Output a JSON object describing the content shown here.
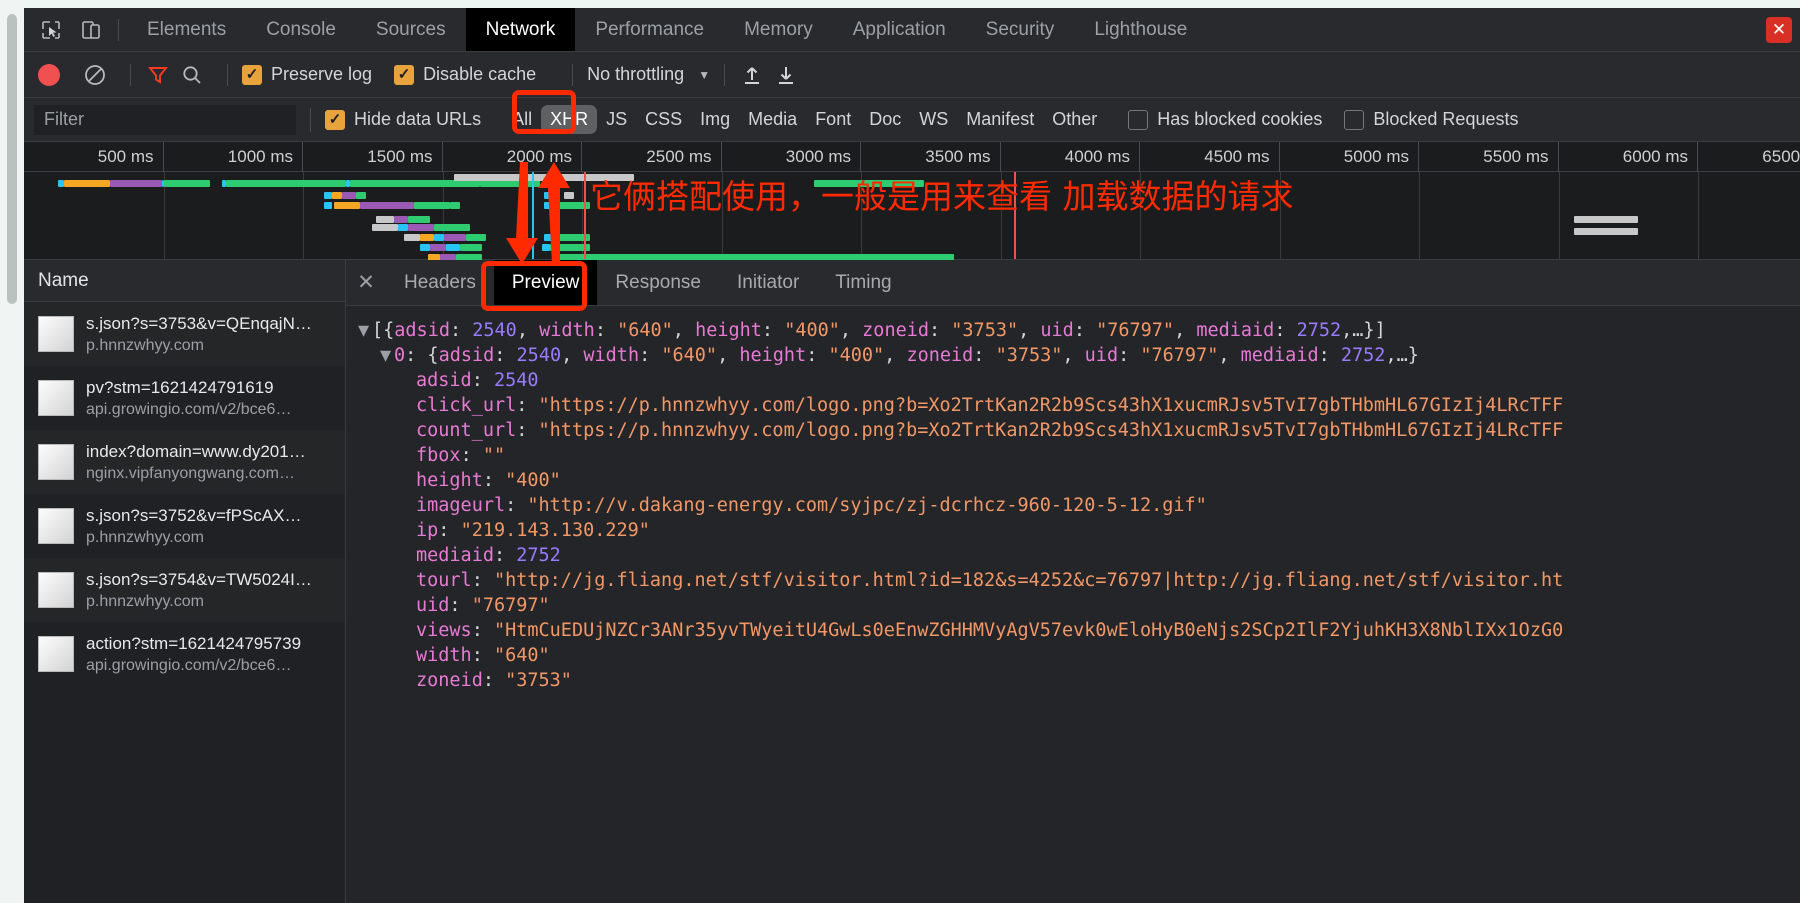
{
  "window": {
    "tabs": [
      {
        "label": "Elements",
        "active": false
      },
      {
        "label": "Console",
        "active": false
      },
      {
        "label": "Sources",
        "active": false
      },
      {
        "label": "Network",
        "active": true
      },
      {
        "label": "Performance",
        "active": false
      },
      {
        "label": "Memory",
        "active": false
      },
      {
        "label": "Application",
        "active": false
      },
      {
        "label": "Security",
        "active": false
      },
      {
        "label": "Lighthouse",
        "active": false
      }
    ],
    "inspect_icon": "cursor-select-icon",
    "device_icon": "device-toolbar-icon",
    "close_icon": "close-icon"
  },
  "toolbar": {
    "record_icon": "record-icon",
    "clear_icon": "clear-icon",
    "filter_icon": "filter-funnel-icon",
    "search_icon": "search-icon",
    "preserve_log": {
      "label": "Preserve log",
      "checked": true
    },
    "disable_cache": {
      "label": "Disable cache",
      "checked": true
    },
    "throttling": "No throttling",
    "throttle_caret": "▼",
    "import_icon": "import-har-icon",
    "export_icon": "export-har-icon"
  },
  "filterbar": {
    "placeholder": "Filter",
    "value": "",
    "hide_data_urls": {
      "label": "Hide data URLs",
      "checked": true
    },
    "types": [
      {
        "label": "All",
        "selected": false
      },
      {
        "label": "XHR",
        "selected": true
      },
      {
        "label": "JS",
        "selected": false
      },
      {
        "label": "CSS",
        "selected": false
      },
      {
        "label": "Img",
        "selected": false
      },
      {
        "label": "Media",
        "selected": false
      },
      {
        "label": "Font",
        "selected": false
      },
      {
        "label": "Doc",
        "selected": false
      },
      {
        "label": "WS",
        "selected": false
      },
      {
        "label": "Manifest",
        "selected": false
      },
      {
        "label": "Other",
        "selected": false
      }
    ],
    "has_blocked_cookies": {
      "label": "Has blocked cookies",
      "checked": false
    },
    "blocked_requests": {
      "label": "Blocked Requests",
      "checked": false
    }
  },
  "overview": {
    "ticks": [
      "500 ms",
      "1000 ms",
      "1500 ms",
      "2000 ms",
      "2500 ms",
      "3000 ms",
      "3500 ms",
      "4000 ms",
      "4500 ms",
      "5000 ms",
      "5500 ms",
      "6000 ms",
      "6500 ms"
    ]
  },
  "requests": {
    "column_header": "Name",
    "rows": [
      {
        "name": "s.json?s=3753&v=QEnqajN…",
        "domain": "p.hnnzwhyy.com"
      },
      {
        "name": "pv?stm=1621424791619",
        "domain": "api.growingio.com/v2/bce6…"
      },
      {
        "name": "index?domain=www.dy201…",
        "domain": "nginx.vipfanyongwang.com…"
      },
      {
        "name": "s.json?s=3752&v=fPScAX…",
        "domain": "p.hnnzwhyy.com"
      },
      {
        "name": "s.json?s=3754&v=TW5024I…",
        "domain": "p.hnnzwhyy.com"
      },
      {
        "name": "action?stm=1621424795739",
        "domain": "api.growingio.com/v2/bce6…"
      }
    ]
  },
  "detail": {
    "close_icon": "close-icon",
    "tabs": [
      {
        "label": "Headers",
        "active": false
      },
      {
        "label": "Preview",
        "active": true
      },
      {
        "label": "Response",
        "active": false
      },
      {
        "label": "Initiator",
        "active": false
      },
      {
        "label": "Timing",
        "active": false
      }
    ],
    "preview_lines": [
      {
        "indent": 0,
        "arrow": "▼",
        "parts": [
          {
            "t": "[{",
            "c": "p"
          },
          {
            "t": "adsid",
            "c": "k"
          },
          {
            "t": ": ",
            "c": "p"
          },
          {
            "t": "2540",
            "c": "n"
          },
          {
            "t": ", ",
            "c": "p"
          },
          {
            "t": "width",
            "c": "k"
          },
          {
            "t": ": ",
            "c": "p"
          },
          {
            "t": "\"640\"",
            "c": "s"
          },
          {
            "t": ", ",
            "c": "p"
          },
          {
            "t": "height",
            "c": "k"
          },
          {
            "t": ": ",
            "c": "p"
          },
          {
            "t": "\"400\"",
            "c": "s"
          },
          {
            "t": ", ",
            "c": "p"
          },
          {
            "t": "zoneid",
            "c": "k"
          },
          {
            "t": ": ",
            "c": "p"
          },
          {
            "t": "\"3753\"",
            "c": "s"
          },
          {
            "t": ", ",
            "c": "p"
          },
          {
            "t": "uid",
            "c": "k"
          },
          {
            "t": ": ",
            "c": "p"
          },
          {
            "t": "\"76797\"",
            "c": "s"
          },
          {
            "t": ", ",
            "c": "p"
          },
          {
            "t": "mediaid",
            "c": "k"
          },
          {
            "t": ": ",
            "c": "p"
          },
          {
            "t": "2752",
            "c": "n"
          },
          {
            "t": ",…}]",
            "c": "p"
          }
        ]
      },
      {
        "indent": 1,
        "arrow": "▼",
        "parts": [
          {
            "t": "0",
            "c": "idx"
          },
          {
            "t": ": {",
            "c": "p"
          },
          {
            "t": "adsid",
            "c": "k"
          },
          {
            "t": ": ",
            "c": "p"
          },
          {
            "t": "2540",
            "c": "n"
          },
          {
            "t": ", ",
            "c": "p"
          },
          {
            "t": "width",
            "c": "k"
          },
          {
            "t": ": ",
            "c": "p"
          },
          {
            "t": "\"640\"",
            "c": "s"
          },
          {
            "t": ", ",
            "c": "p"
          },
          {
            "t": "height",
            "c": "k"
          },
          {
            "t": ": ",
            "c": "p"
          },
          {
            "t": "\"400\"",
            "c": "s"
          },
          {
            "t": ", ",
            "c": "p"
          },
          {
            "t": "zoneid",
            "c": "k"
          },
          {
            "t": ": ",
            "c": "p"
          },
          {
            "t": "\"3753\"",
            "c": "s"
          },
          {
            "t": ", ",
            "c": "p"
          },
          {
            "t": "uid",
            "c": "k"
          },
          {
            "t": ": ",
            "c": "p"
          },
          {
            "t": "\"76797\"",
            "c": "s"
          },
          {
            "t": ", ",
            "c": "p"
          },
          {
            "t": "mediaid",
            "c": "k"
          },
          {
            "t": ": ",
            "c": "p"
          },
          {
            "t": "2752",
            "c": "n"
          },
          {
            "t": ",…}",
            "c": "p"
          }
        ]
      },
      {
        "indent": 2,
        "arrow": "",
        "parts": [
          {
            "t": "adsid",
            "c": "k"
          },
          {
            "t": ": ",
            "c": "p"
          },
          {
            "t": "2540",
            "c": "n"
          }
        ]
      },
      {
        "indent": 2,
        "arrow": "",
        "parts": [
          {
            "t": "click_url",
            "c": "k"
          },
          {
            "t": ": ",
            "c": "p"
          },
          {
            "t": "\"https://p.hnnzwhyy.com/logo.png?b=Xo2TrtKan2R2b9Scs43hX1xucmRJsv5TvI7gbTHbmHL67GIzIj4LRcTFF",
            "c": "s"
          }
        ]
      },
      {
        "indent": 2,
        "arrow": "",
        "parts": [
          {
            "t": "count_url",
            "c": "k"
          },
          {
            "t": ": ",
            "c": "p"
          },
          {
            "t": "\"https://p.hnnzwhyy.com/logo.png?b=Xo2TrtKan2R2b9Scs43hX1xucmRJsv5TvI7gbTHbmHL67GIzIj4LRcTFF",
            "c": "s"
          }
        ]
      },
      {
        "indent": 2,
        "arrow": "",
        "parts": [
          {
            "t": "fbox",
            "c": "k"
          },
          {
            "t": ": ",
            "c": "p"
          },
          {
            "t": "\"\"",
            "c": "s"
          }
        ]
      },
      {
        "indent": 2,
        "arrow": "",
        "parts": [
          {
            "t": "height",
            "c": "k"
          },
          {
            "t": ": ",
            "c": "p"
          },
          {
            "t": "\"400\"",
            "c": "s"
          }
        ]
      },
      {
        "indent": 2,
        "arrow": "",
        "parts": [
          {
            "t": "imageurl",
            "c": "k"
          },
          {
            "t": ": ",
            "c": "p"
          },
          {
            "t": "\"http://v.dakang-energy.com/syjpc/zj-dcrhcz-960-120-5-12.gif\"",
            "c": "s"
          }
        ]
      },
      {
        "indent": 2,
        "arrow": "",
        "parts": [
          {
            "t": "ip",
            "c": "k"
          },
          {
            "t": ": ",
            "c": "p"
          },
          {
            "t": "\"219.143.130.229\"",
            "c": "s"
          }
        ]
      },
      {
        "indent": 2,
        "arrow": "",
        "parts": [
          {
            "t": "mediaid",
            "c": "k"
          },
          {
            "t": ": ",
            "c": "p"
          },
          {
            "t": "2752",
            "c": "n"
          }
        ]
      },
      {
        "indent": 2,
        "arrow": "",
        "parts": [
          {
            "t": "tourl",
            "c": "k"
          },
          {
            "t": ": ",
            "c": "p"
          },
          {
            "t": "\"http://jg.fliang.net/stf/visitor.html?id=182&s=4252&c=76797|http://jg.fliang.net/stf/visitor.ht",
            "c": "s"
          }
        ]
      },
      {
        "indent": 2,
        "arrow": "",
        "parts": [
          {
            "t": "uid",
            "c": "k"
          },
          {
            "t": ": ",
            "c": "p"
          },
          {
            "t": "\"76797\"",
            "c": "s"
          }
        ]
      },
      {
        "indent": 2,
        "arrow": "",
        "parts": [
          {
            "t": "views",
            "c": "k"
          },
          {
            "t": ": ",
            "c": "p"
          },
          {
            "t": "\"HtmCuEDUjNZCr3ANr35yvTWyeitU4GwLs0eEnwZGHHMVyAgV57evk0wEloHyB0eNjs2SCp2IlF2YjuhKH3X8NblIXx1OzG0",
            "c": "s"
          }
        ]
      },
      {
        "indent": 2,
        "arrow": "",
        "parts": [
          {
            "t": "width",
            "c": "k"
          },
          {
            "t": ": ",
            "c": "p"
          },
          {
            "t": "\"640\"",
            "c": "s"
          }
        ]
      },
      {
        "indent": 2,
        "arrow": "",
        "parts": [
          {
            "t": "zoneid",
            "c": "k"
          },
          {
            "t": ": ",
            "c": "p"
          },
          {
            "t": "\"3753\"",
            "c": "s"
          }
        ]
      }
    ]
  },
  "annotations": {
    "note_text": "它俩搭配使用，一般是用来查看  加载数据的请求",
    "color": "#ff2a00",
    "xhr_highlight": "xhr-filter-highlight",
    "preview_highlight": "preview-tab-highlight",
    "arrow_down": "arrow-down-annotation",
    "arrow_up": "arrow-up-annotation"
  }
}
